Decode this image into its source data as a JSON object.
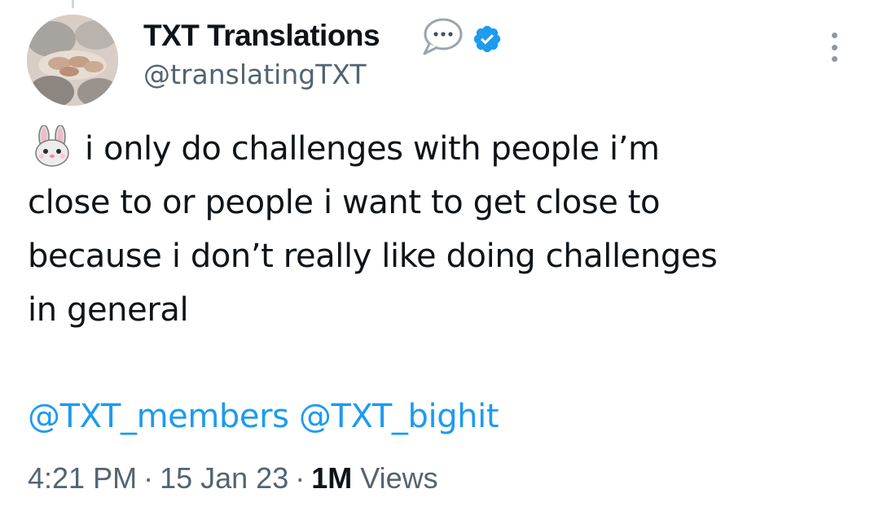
{
  "author": {
    "display_name": "TXT Translations",
    "handle": "@translatingTXT",
    "verified_color": "#1d9bf0"
  },
  "tweet": {
    "emoji": "rabbit-face-icon",
    "lines": [
      "i only do challenges with people i’m",
      "close to or people i want to get close to",
      "because i don’t really like doing challenges",
      "in general"
    ],
    "mentions": [
      "@TXT_members",
      "@TXT_bighit"
    ]
  },
  "meta": {
    "time": "4:21 PM",
    "separator": "·",
    "date": "15 Jan 23",
    "views_count": "1M",
    "views_label": "Views"
  },
  "colors": {
    "text": "#0f1419",
    "secondary": "#536471",
    "link": "#1d9bf0"
  }
}
